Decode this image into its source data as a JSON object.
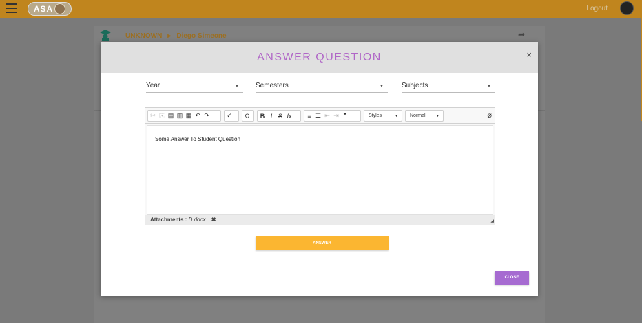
{
  "topbar": {
    "logo_text": "ASA",
    "logout_label": "Logout"
  },
  "breadcrumb": {
    "category": "UNKNOWN",
    "separator": "▸",
    "student": "Diego Simeone"
  },
  "modal": {
    "title": "ANSWER QUESTION",
    "close_x": "×",
    "selects": {
      "year": "Year",
      "semesters": "Semesters",
      "subjects": "Subjects"
    },
    "editor": {
      "styles_combo": "Styles",
      "format_combo": "Normal",
      "content": "Some Answer To Student Question",
      "attachments_label": "Attachments :",
      "attachment_file": "D.docx",
      "remove_attachment": "✖"
    },
    "answer_button": "ANSWER",
    "close_button": "CLOSE"
  },
  "colors": {
    "topbar": "#c0851e",
    "title": "#b066c7",
    "answer_button": "#fbb631",
    "close_button": "#a66bd1"
  }
}
